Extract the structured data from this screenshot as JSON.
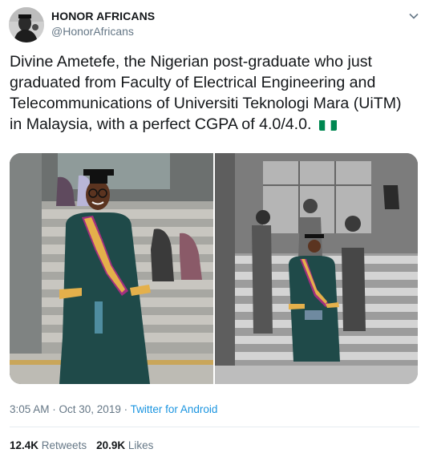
{
  "author": {
    "name": "HONOR AFRICANS",
    "handle": "@HonorAfricans"
  },
  "tweet": {
    "text": "Divine Ametefe, the Nigerian post-graduate who just graduated from Faculty of Electrical Engineering and Telecommunications of Universiti Teknologi Mara (UiTM) in Malaysia, with a perfect CGPA of 4.0/4.0.",
    "flag_icon": "nigeria-flag-icon"
  },
  "meta": {
    "time": "3:05 AM",
    "date": "Oct 30, 2019",
    "separator": " · ",
    "source": "Twitter for Android"
  },
  "stats": {
    "retweets_count": "12.4K",
    "retweets_label": "Retweets",
    "likes_count": "20.9K",
    "likes_label": "Likes"
  },
  "colors": {
    "text": "#14171a",
    "secondary": "#657786",
    "link": "#1b95e0",
    "flag_green": "#008751"
  }
}
